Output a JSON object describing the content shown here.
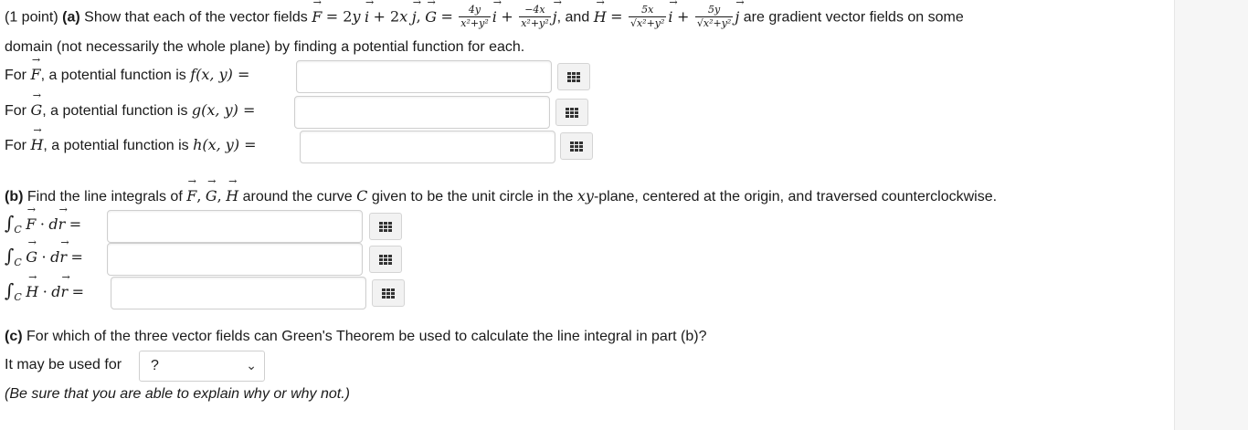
{
  "intro": {
    "points": "(1 point)",
    "part_a_label": "(a)",
    "part_a_text": "Show that each of the vector fields",
    "and_word": ", and",
    "tail": "are gradient vector fields on some",
    "line2": "domain (not necessarily the whole plane) by finding a potential function for each."
  },
  "potential_rows": [
    {
      "prefix": "For ",
      "field": "F",
      "text": ", a potential function is ",
      "fn": "f(x, y) ="
    },
    {
      "prefix": "For ",
      "field": "G",
      "text": ", a potential function is ",
      "fn": "g(x, y) ="
    },
    {
      "prefix": "For ",
      "field": "H",
      "text": ", a potential function is ",
      "fn": "h(x, y) ="
    }
  ],
  "part_b": {
    "label": "(b)",
    "text1": "Find the line integrals of",
    "text2": "around the curve",
    "text3": "given to be the unit circle in the",
    "plane_var": "xy",
    "text4": "-plane, centered at the origin, and traversed counterclockwise."
  },
  "integrals": [
    {
      "field": "F"
    },
    {
      "field": "G"
    },
    {
      "field": "H"
    }
  ],
  "part_c": {
    "label": "(c)",
    "question": "For which of the three vector fields can Green's Theorem be used to calculate the line integral in part (b)?",
    "select_label": "It may be used for",
    "select_value": "?",
    "note": "(Be sure that you are able to explain why or why not.)"
  },
  "icons": {
    "matrix": "matrix-grid-icon",
    "dropdown": "chevron-down-icon"
  }
}
